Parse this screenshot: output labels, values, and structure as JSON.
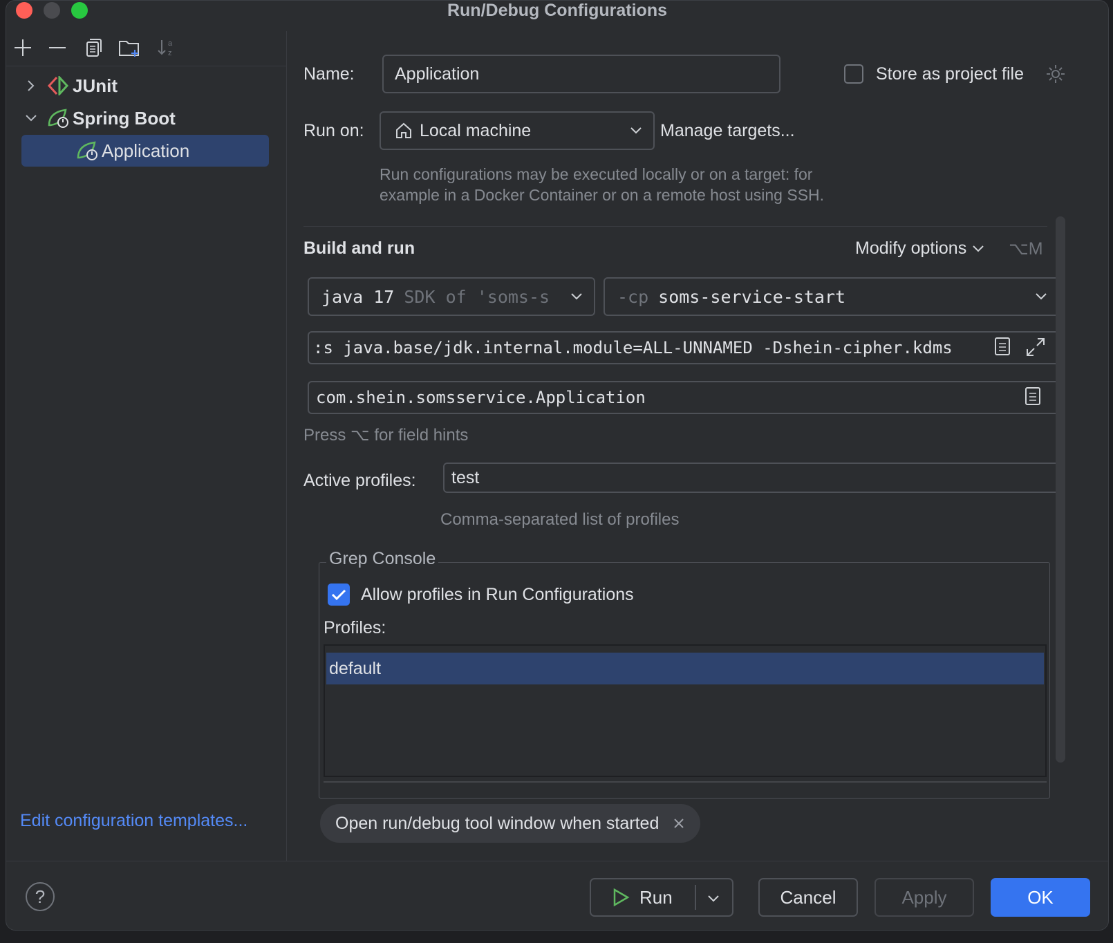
{
  "window": {
    "title": "Run/Debug Configurations"
  },
  "tree": {
    "items": [
      {
        "label": "JUnit"
      },
      {
        "label": "Spring Boot"
      },
      {
        "label": "Application"
      }
    ],
    "edit_templates": "Edit configuration templates..."
  },
  "form": {
    "name_label": "Name:",
    "name_value": "Application",
    "store_label": "Store as project file",
    "run_on_label": "Run on:",
    "run_on_value": "Local machine",
    "manage_targets": "Manage targets...",
    "run_on_hint_1": "Run configurations may be executed locally or on a target: for",
    "run_on_hint_2": "example in a Docker Container or on a remote host using SSH.",
    "build_title": "Build and run",
    "modify_options": "Modify options",
    "modify_shortcut": "⌥M",
    "jre_main": "java 17",
    "jre_sub": "SDK of 'soms-s",
    "cp_prefix": "-cp",
    "cp_value": "soms-service-start",
    "vm_options": ":s java.base/jdk.internal.module=ALL-UNNAMED -Dshein-cipher.kdms",
    "main_class": "com.shein.somsservice.Application",
    "field_hint": "Press ⌥ for field hints",
    "profiles_label": "Active profiles:",
    "profiles_value": "test",
    "profiles_hint": "Comma-separated list of profiles",
    "grep_title": "Grep Console",
    "allow_profiles": "Allow profiles in Run Configurations",
    "profiles_list_label": "Profiles:",
    "profiles_list": [
      "default"
    ],
    "chip_label": "Open run/debug tool window when started"
  },
  "buttons": {
    "help": "?",
    "run": "Run",
    "cancel": "Cancel",
    "apply": "Apply",
    "ok": "OK"
  },
  "colors": {
    "accent": "#3574f0",
    "link": "#548af7",
    "selection": "#2e436e",
    "spring_green": "#5fb85f",
    "junit_red": "#e55b5b"
  }
}
